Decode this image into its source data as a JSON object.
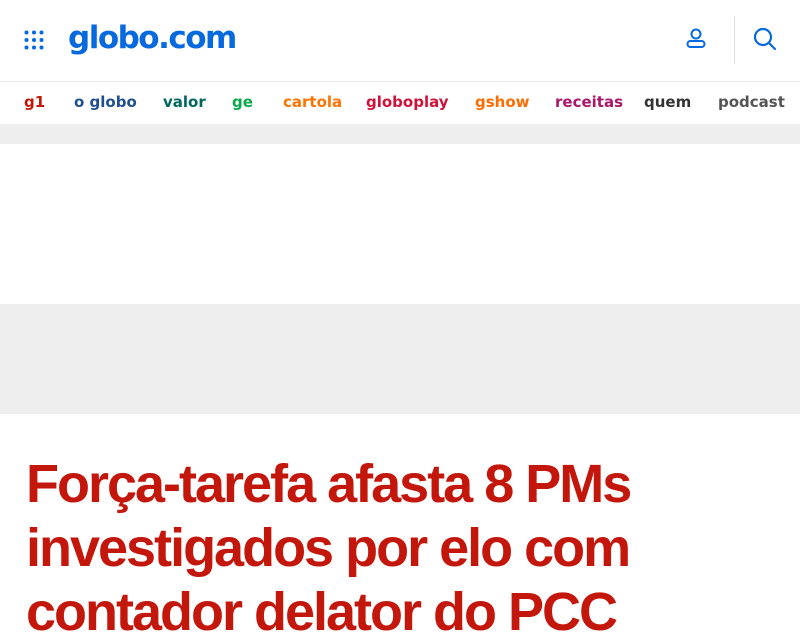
{
  "header": {
    "logo": "globo.com",
    "menu_icon": "grid-menu-icon",
    "account_icon": "user-icon",
    "search_icon": "search-icon"
  },
  "nav": {
    "items": [
      {
        "label": "g1",
        "color": "#c4170c"
      },
      {
        "label": "o globo",
        "color": "#1d4f91"
      },
      {
        "label": "valor",
        "color": "#00665e"
      },
      {
        "label": "ge",
        "color": "#06aa48"
      },
      {
        "label": "cartola",
        "color": "#ff7300"
      },
      {
        "label": "globoplay",
        "color": "#d0113a"
      },
      {
        "label": "gshow",
        "color": "#ff6c00"
      },
      {
        "label": "receitas",
        "color": "#a8176a"
      },
      {
        "label": "quem",
        "color": "#333333"
      },
      {
        "label": "podcast",
        "color": "#555555"
      }
    ]
  },
  "article": {
    "headline": "Força-tarefa afasta 8 PMs investigados por elo com contador delator do PCC"
  },
  "colors": {
    "brand_blue": "#0669de",
    "headline_red": "#c4170c",
    "gray_block": "#eeeeee"
  }
}
